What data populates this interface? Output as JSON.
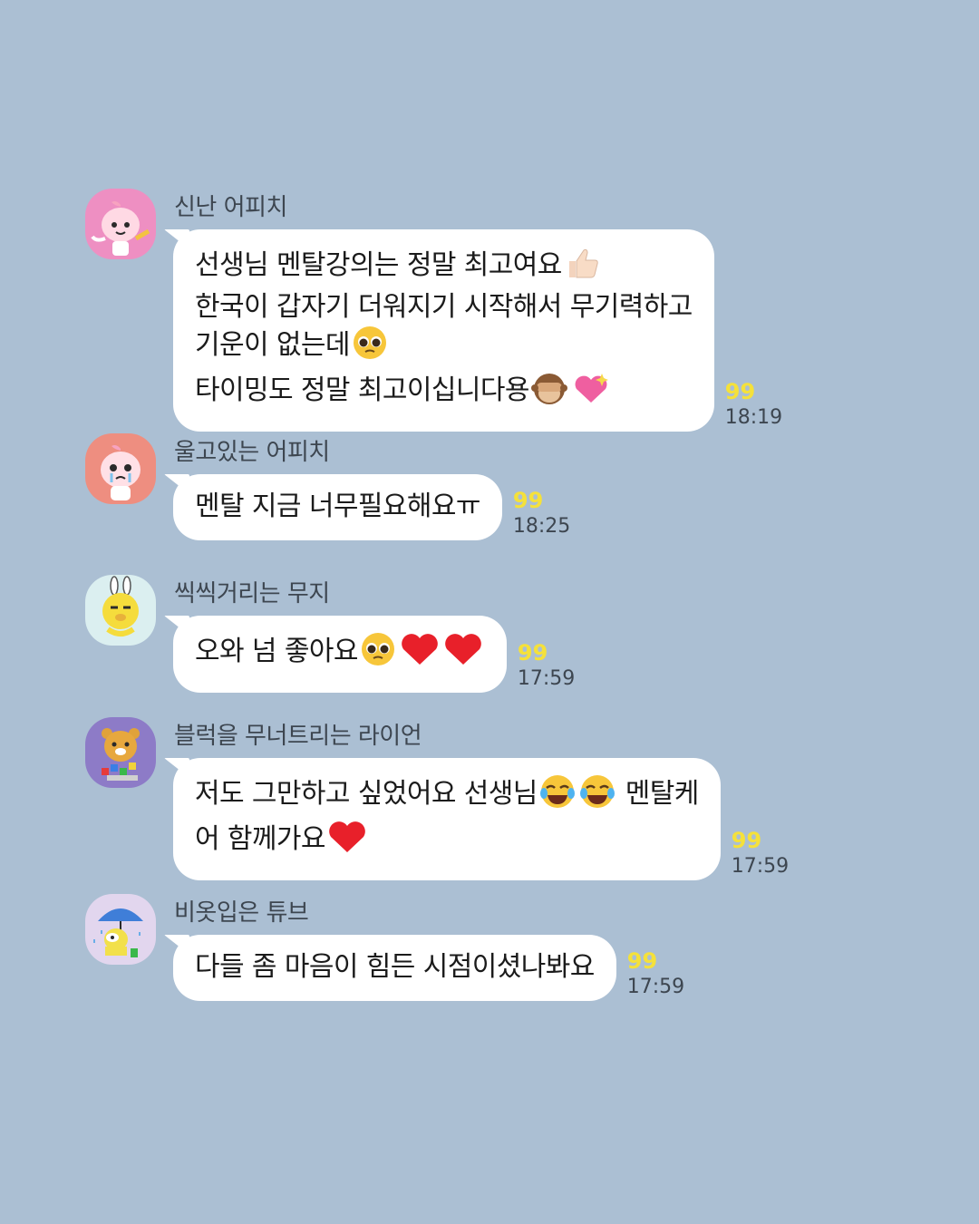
{
  "messages": [
    {
      "sender": "신난 어피치",
      "avatar_icon": "apeach-happy-avatar-icon",
      "lines": [
        "선생님 멘탈강의는 정말 최고여요",
        "한국이 갑자기 더워지기 시작해서 무기력하고",
        "기운이 없는데",
        "타이밍도 정말 최고이십니다용"
      ],
      "unread": "99",
      "time": "18:19"
    },
    {
      "sender": "울고있는 어피치",
      "avatar_icon": "apeach-crying-avatar-icon",
      "lines": [
        "멘탈 지금 너무필요해요ㅠ"
      ],
      "unread": "99",
      "time": "18:25"
    },
    {
      "sender": "씩씩거리는 무지",
      "avatar_icon": "muzi-avatar-icon",
      "lines": [
        "오와 넘 좋아요"
      ],
      "unread": "99",
      "time": "17:59"
    },
    {
      "sender": "블럭을 무너트리는 라이언",
      "avatar_icon": "ryan-avatar-icon",
      "lines": [
        "저도 그만하고 싶었어요 선생님",
        "멘탈케",
        "어 함께가요"
      ],
      "unread": "99",
      "time": "17:59"
    },
    {
      "sender": "비옷입은 튜브",
      "avatar_icon": "tube-umbrella-avatar-icon",
      "lines": [
        "다들 좀 마음이 힘든 시점이셨나봐요"
      ],
      "unread": "99",
      "time": "17:59"
    }
  ],
  "colors": {
    "background": "#abbfd3",
    "bubble": "#ffffff",
    "unread": "#f5e13a",
    "meta_text": "#3d4650"
  }
}
